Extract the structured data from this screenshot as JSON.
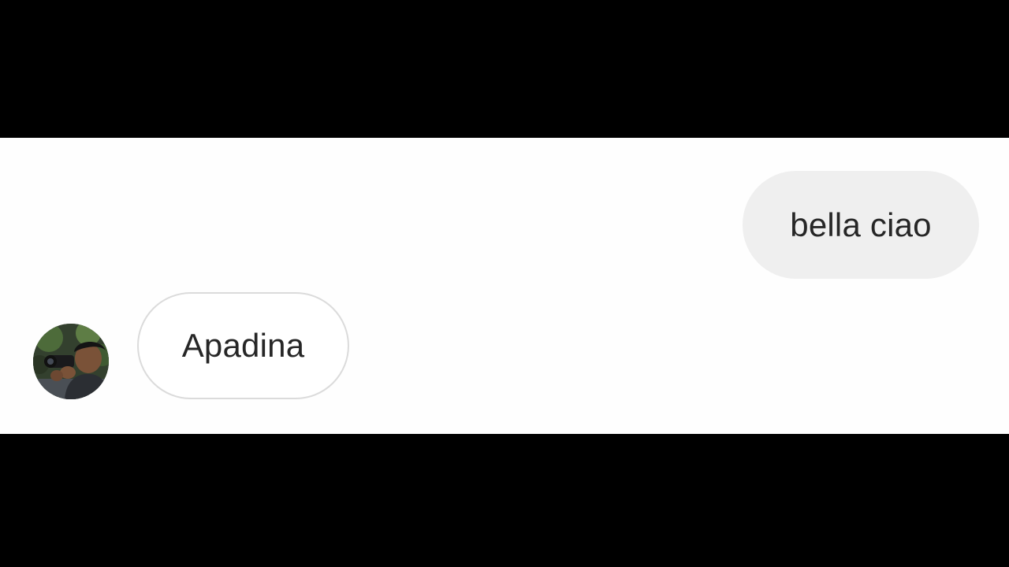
{
  "conversation": {
    "messages": [
      {
        "direction": "outgoing",
        "text": "bella ciao"
      },
      {
        "direction": "incoming",
        "text": "Apadina",
        "sender_avatar": "person-with-camera-avatar"
      }
    ]
  },
  "colors": {
    "letterbox": "#000000",
    "chat_background": "#fefefe",
    "outgoing_bubble": "#efefef",
    "incoming_bubble_border": "#dbdbdb",
    "text": "#262626"
  }
}
